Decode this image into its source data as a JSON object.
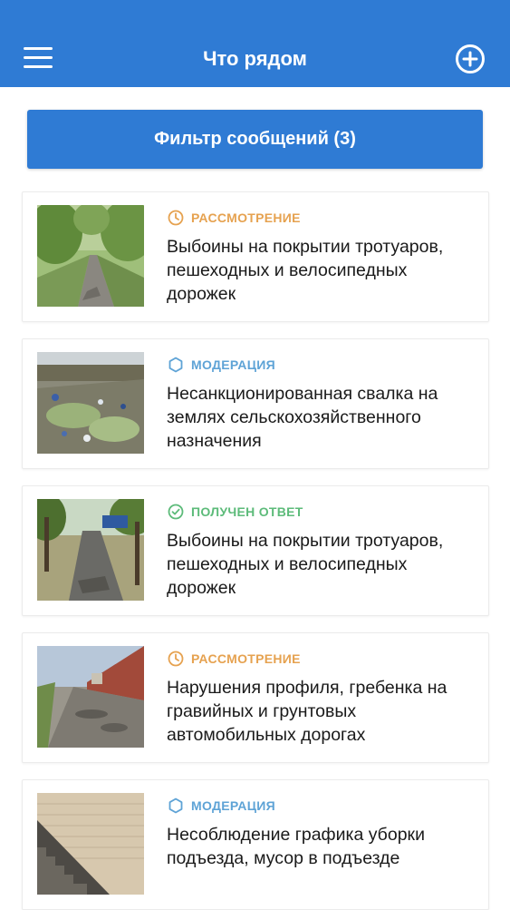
{
  "header": {
    "title": "Что рядом",
    "menu_icon": "hamburger-menu-icon",
    "add_icon": "plus-circle-icon"
  },
  "filter": {
    "label": "Фильтр сообщений (3)"
  },
  "colors": {
    "primary": "#2f7bd4",
    "status_review": "#e6a250",
    "status_moderation": "#5ea3d6",
    "status_answered": "#5dbb7a"
  },
  "items": [
    {
      "status": "РАССМОТРЕНИЕ",
      "status_icon": "clock-icon",
      "title": "Выбоины на покрытии тротуаров, пешеходных и велосипедных дорожек",
      "photo": "damaged park path photo"
    },
    {
      "status": "МОДЕРАЦИЯ",
      "status_icon": "hexagon-icon",
      "title": "Несанкционированная свалка на землях сельскохозяйственного назначения",
      "photo": "illegal dump photo"
    },
    {
      "status": "ПОЛУЧЕН ОТВЕТ",
      "status_icon": "check-circle-icon",
      "title": "Выбоины на покрытии тротуаров, пешеходных и велосипедных дорожек",
      "photo": "damaged sidewalk photo"
    },
    {
      "status": "РАССМОТРЕНИЕ",
      "status_icon": "clock-icon",
      "title": "Нарушения профиля, гребенка на гравийных и грунтовых автомобильных дорогах",
      "photo": "potholed road photo"
    },
    {
      "status": "МОДЕРАЦИЯ",
      "status_icon": "hexagon-icon",
      "title": "Несоблюдение графика уборки подъезда, мусор в подъезде",
      "photo": "dirty stairway photo"
    }
  ]
}
